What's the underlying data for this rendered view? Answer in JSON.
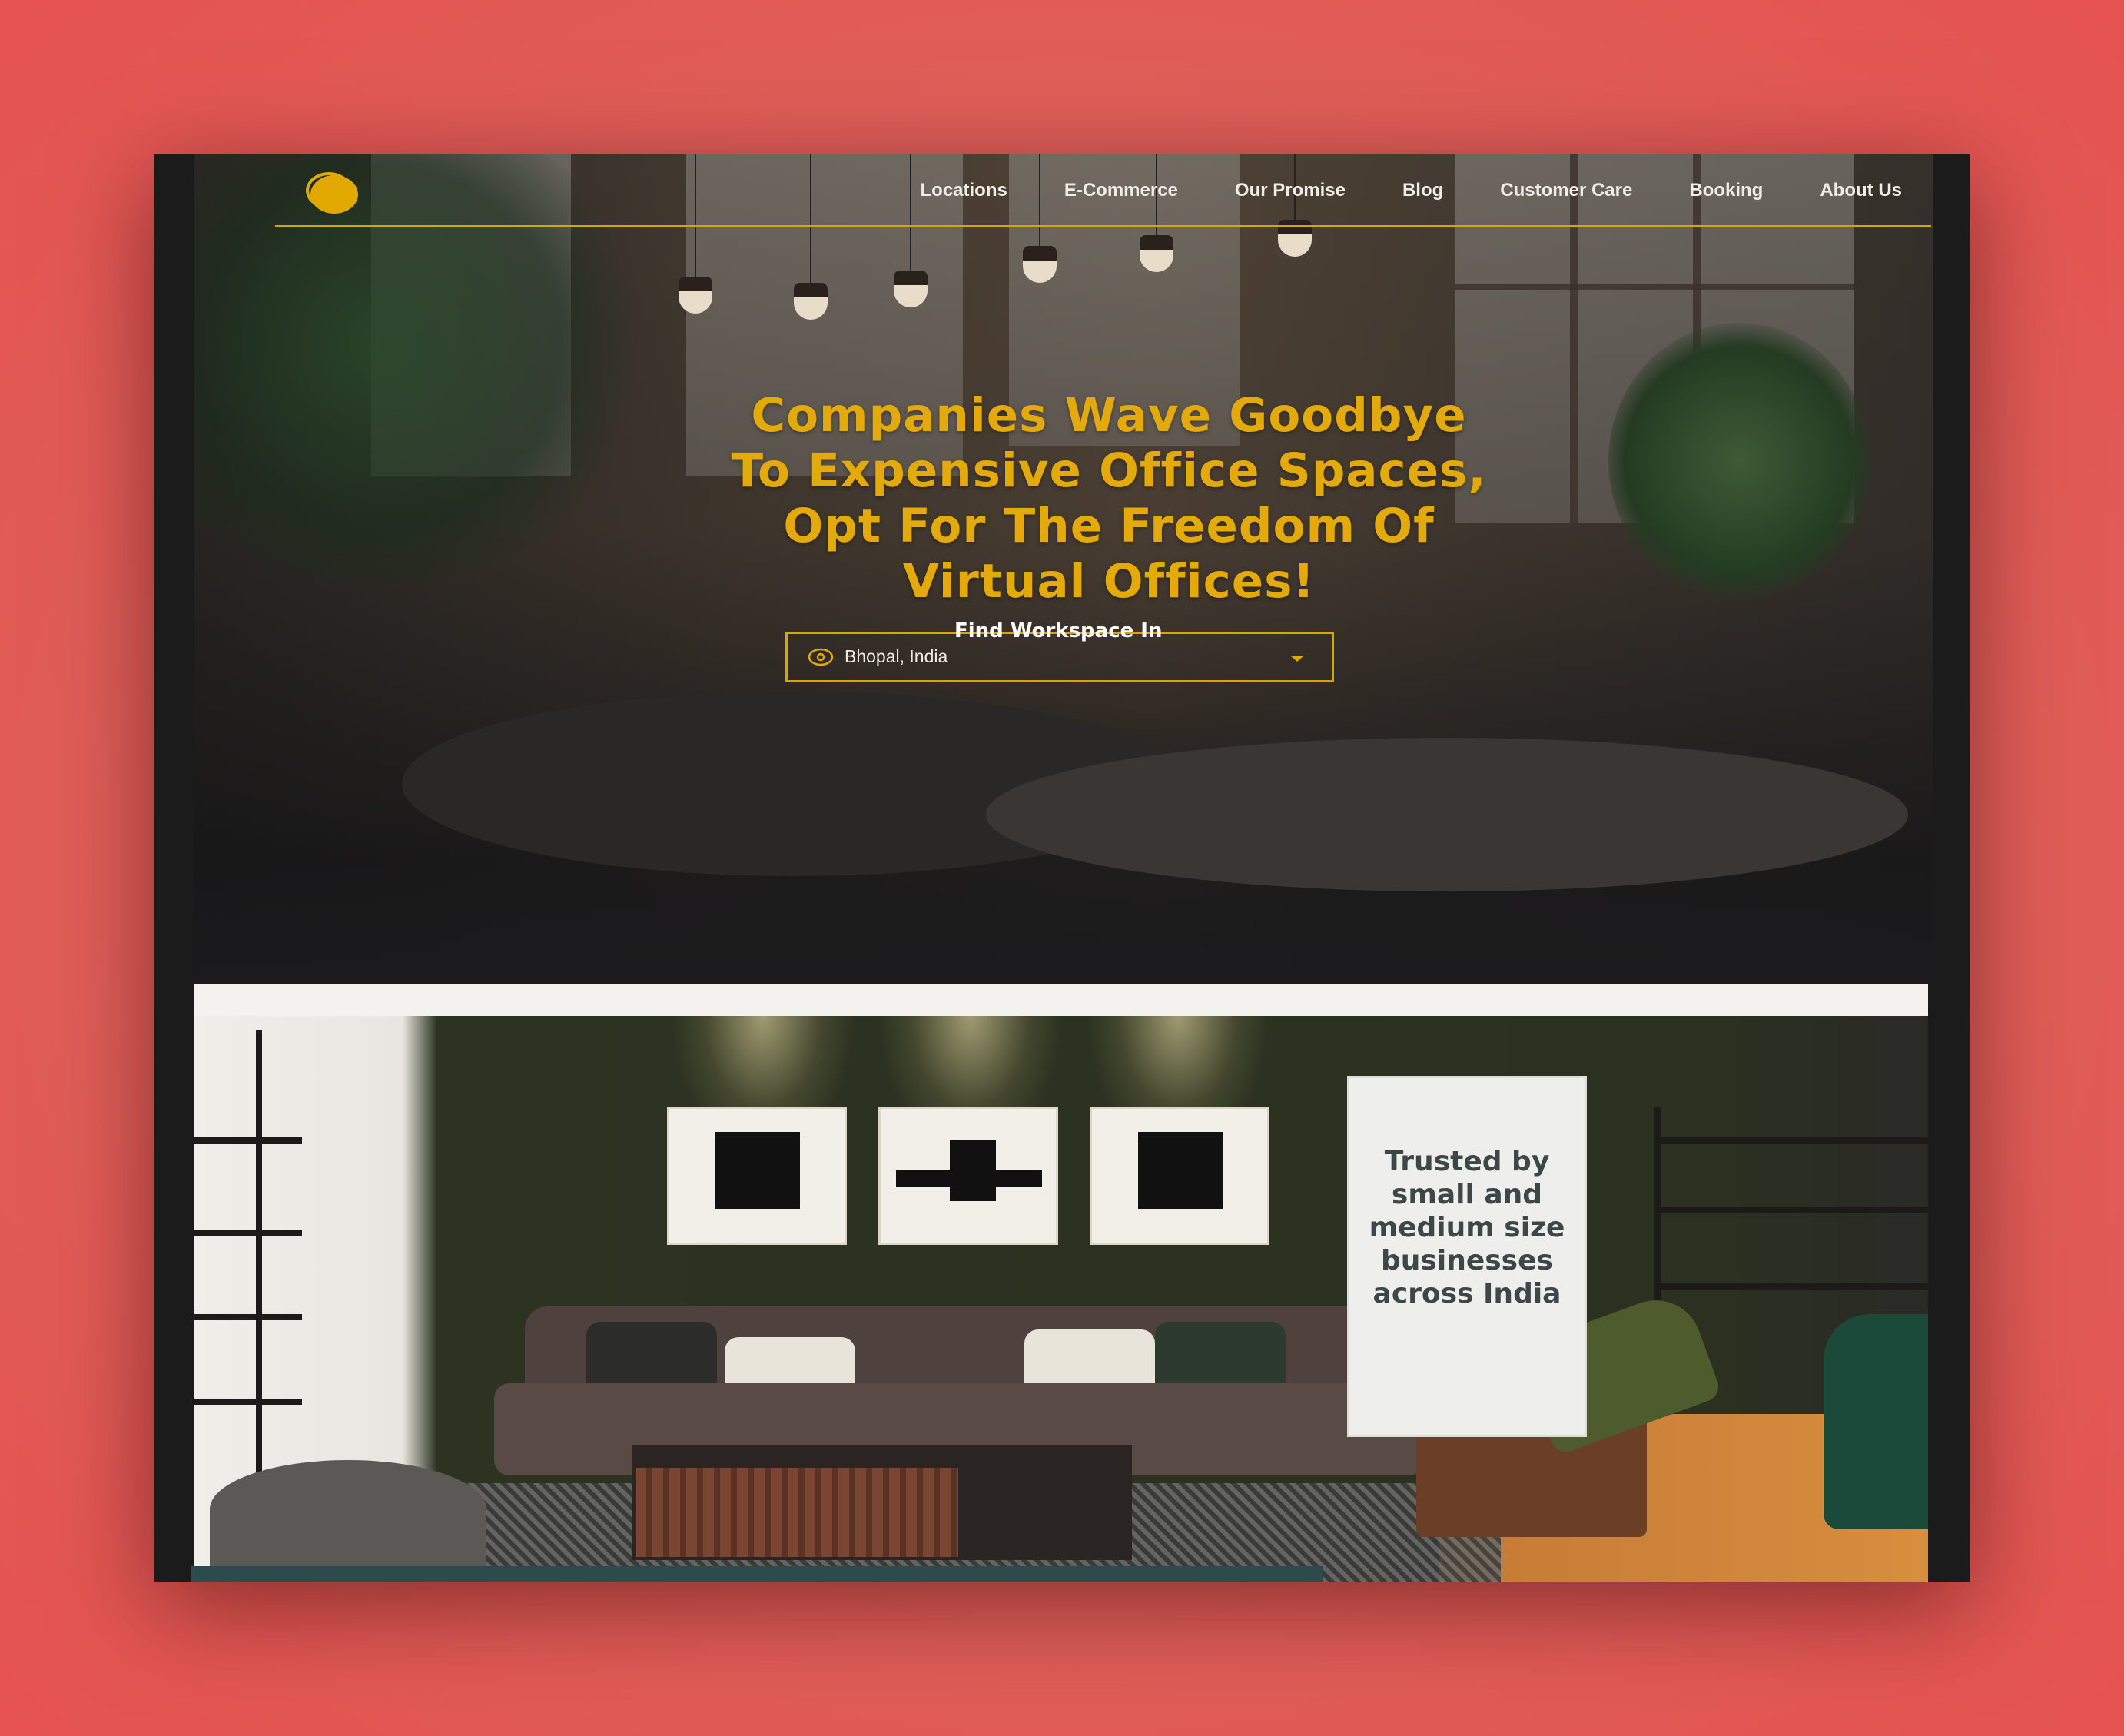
{
  "nav": {
    "links": [
      "Locations",
      "E-Commerce",
      "Our Promise",
      "Blog",
      "Customer Care",
      "Booking",
      "About Us"
    ]
  },
  "hero": {
    "headline_lines": [
      "Companies Wave Goodbye",
      "To Expensive Office Spaces,",
      "Opt For The Freedom Of",
      "Virtual Offices!"
    ],
    "finder_label": "Find Workspace In",
    "finder_value": "Bhopal, India",
    "finder_icon": "location-pin-icon"
  },
  "trust": {
    "lines": [
      "Trusted by",
      "small and",
      "medium size",
      "businesses",
      "across India"
    ]
  },
  "colors": {
    "accent": "#e1a900",
    "background": "#e0605a",
    "frame": "#1b1b1c",
    "trust_text": "#3e4747"
  }
}
